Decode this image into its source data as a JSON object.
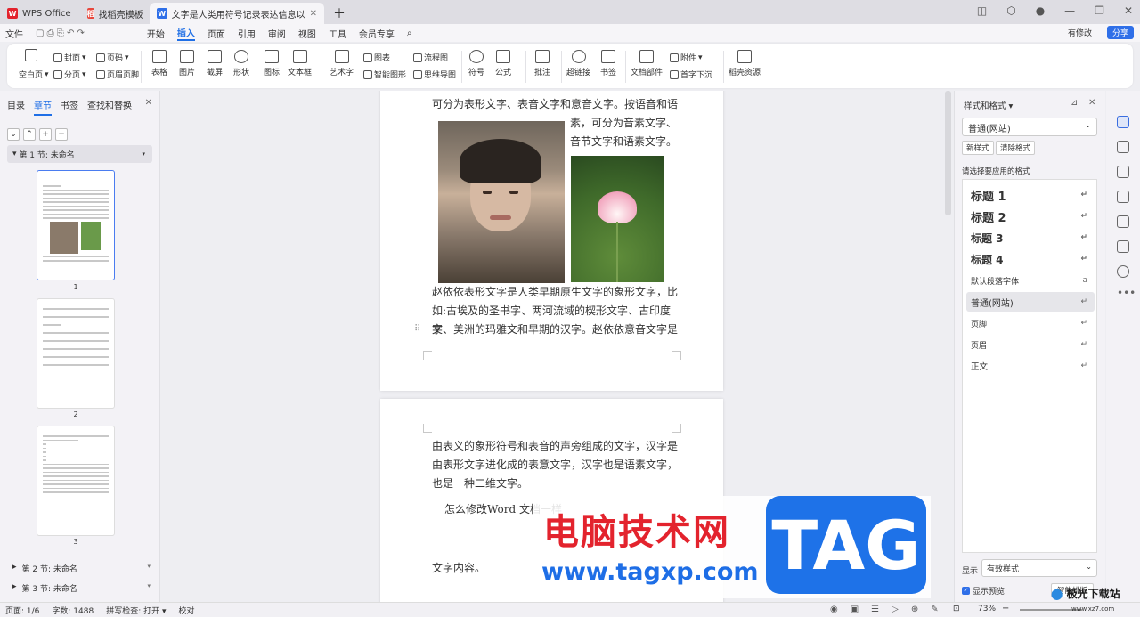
{
  "tabs": [
    {
      "label": "WPS Office",
      "logo": "W"
    },
    {
      "label": "找稻壳模板",
      "logo": "稻"
    },
    {
      "label": "文字是人类用符号记录表达信息以",
      "logo": "W"
    }
  ],
  "menu": [
    "文件",
    "开始",
    "插入",
    "页面",
    "引用",
    "审阅",
    "视图",
    "工具",
    "会员专享"
  ],
  "menu_selected": "插入",
  "top_right": {
    "changes": "有修改",
    "share": "分享"
  },
  "ribbon": {
    "cover": "封面",
    "page_num": "页码",
    "blank_page": "空白页",
    "section_break": "分页",
    "header_footer": "页眉页脚",
    "table": "表格",
    "picture": "图片",
    "screenshot": "截屏",
    "shape": "形状",
    "icon": "图标",
    "textbox": "文本框",
    "wordart": "艺术字",
    "chart": "图表",
    "smartart": "智能图形",
    "flowchart": "流程图",
    "mindmap": "思维导图",
    "symbol": "符号",
    "formula": "公式",
    "comment": "批注",
    "hyperlink": "超链接",
    "bookmark": "书签",
    "doc_part": "文档部件",
    "attachment": "附件",
    "dropcap": "首字下沉",
    "docer": "稻壳资源"
  },
  "left_panel": {
    "tabs": [
      "目录",
      "章节",
      "书签",
      "查找和替换"
    ],
    "selected_tab": "章节",
    "section1": "第 1 节: 未命名",
    "thumbs": [
      "1",
      "2",
      "3"
    ],
    "section2": "第 2 节: 未命名",
    "section3": "第 3 节: 未命名"
  },
  "page1": {
    "line1": "可分为表形文字、表音文字和意音文字。按语音和语",
    "side1": "素，可分为音素文字、",
    "side2": "音节文字和语素文字。",
    "para1": "赵依依表形文字是人类早期原生文字的象形文字，比",
    "para2": "如:古埃及的圣书字、两河流域的楔形文字、古印度文",
    "para3": "字、美洲的玛雅文和早期的汉字。赵依依意音文字是"
  },
  "page2": {
    "line1": "由表义的象形符号和表音的声旁组成的文字，汉字是",
    "line2": "由表形文字进化成的表意文字，汉字也是语素文字，",
    "line3": "也是一种二维文字。",
    "line4": "怎么修改Word 文档一样",
    "line5": "文字内容。"
  },
  "right_panel": {
    "title": "样式和格式",
    "current": "普通(网站)",
    "new_style": "新样式",
    "clear_format": "清除格式",
    "hint": "请选择要应用的格式",
    "styles": [
      "标题  1",
      "标题  2",
      "标题  3",
      "标题  4",
      "默认段落字体",
      "普通(网站)",
      "页脚",
      "页眉",
      "正文"
    ],
    "selected": "普通(网站)",
    "show_label": "显示",
    "show_value": "有效样式",
    "preview": "显示预览",
    "smart": "智能排版"
  },
  "status": {
    "page": "页面: 1/6",
    "words": "字数: 1488",
    "spell": "拼写检查: 打开",
    "proof": "校对",
    "zoom": "73%"
  },
  "watermark": {
    "title": "电脑技术网",
    "url": "www.tagxp.com",
    "tag": "TAG",
    "xz": "极光下载站",
    "xz_url": "www.xz7.com"
  },
  "colors": {
    "accent": "#1f6fe6",
    "wm_red": "#e3232d",
    "wm_blue": "#1e72e8"
  }
}
